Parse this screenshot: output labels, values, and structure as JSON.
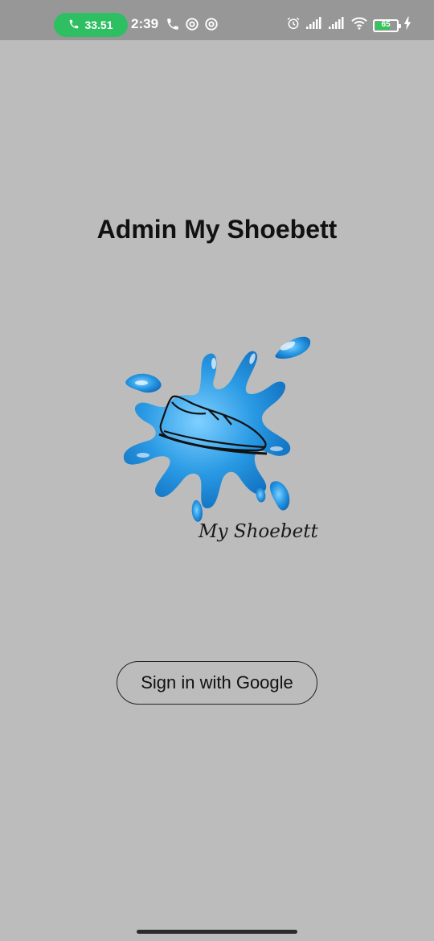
{
  "status_bar": {
    "call_timer": "33.51",
    "time": "2:39",
    "battery_level": "65",
    "battery_fraction": 0.65
  },
  "main": {
    "title": "Admin My Shoebett",
    "logo_caption": "My Shoebett",
    "sign_in_label": "Sign in with Google"
  },
  "colors": {
    "background": "#bcbcbc",
    "status_bar": "#979797",
    "call_pill": "#2fbf63",
    "splash_blue": "#2a9ae4"
  }
}
